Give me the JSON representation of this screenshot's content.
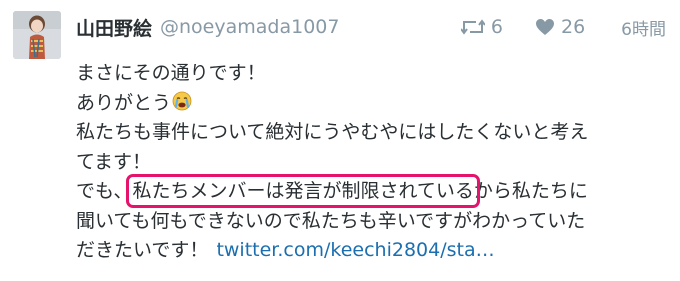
{
  "author": {
    "display_name": "山田野絵",
    "screen_name": "@noeyamada1007"
  },
  "stats": {
    "retweets": "6",
    "likes": "26",
    "timestamp": "6時間"
  },
  "icons": {
    "retweet": "retweet-icon",
    "like": "heart-icon",
    "emoji": "crying-face-emoji"
  },
  "colors": {
    "highlight": "#e5136b",
    "link": "#1b6fb0",
    "meta": "#8899a6"
  },
  "tweet": {
    "line1": "まさにその通りです！",
    "line2": "ありがとう",
    "line3": "私たちも事件について絶対にうやむやにはしたくないと考え",
    "line4": "てます！",
    "line5_pre": "でも、",
    "line5_highlight": "私たちメンバーは発言が制限されている",
    "line5_post": "から私たちに",
    "line6": "聞いても何もできないので私たちも辛いですがわかっていた",
    "line7": "だきたいです！",
    "link": "twitter.com/keechi2804/sta…"
  }
}
